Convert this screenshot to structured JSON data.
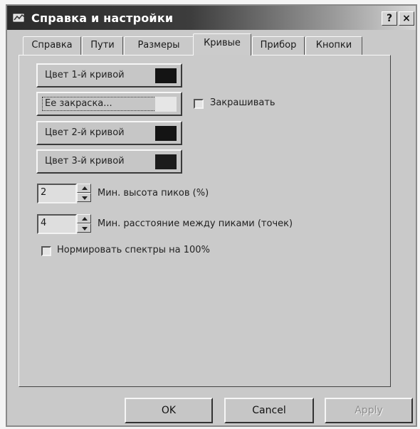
{
  "window": {
    "title": "Справка и настройки",
    "help_label": "?",
    "close_label": "×"
  },
  "tabs": [
    {
      "label": "Справка"
    },
    {
      "label": "Пути"
    },
    {
      "label": "Размеры"
    },
    {
      "label": "Кривые",
      "active": true
    },
    {
      "label": "Прибор"
    },
    {
      "label": "Кнопки"
    }
  ],
  "curves": {
    "color1_label": "Цвет 1-й кривой",
    "fill_label": "Ее закраска...",
    "color2_label": "Цвет 2-й кривой",
    "color3_label": "Цвет 3-й кривой",
    "fill_checkbox_label": "Закрашивать",
    "fill_checked": false,
    "min_peak_height_value": "2",
    "min_peak_height_label": "Мин. высота пиков (%)",
    "min_peak_distance_value": "4",
    "min_peak_distance_label": "Мин. расстояние между пиками (точек)",
    "normalize_label": "Нормировать спектры на 100%",
    "normalize_checked": false,
    "swatch_colors": {
      "color1": "#141414",
      "fill": "#e6e6e6",
      "color2": "#141414",
      "color3": "#1c1c1c"
    }
  },
  "buttons": {
    "ok": "OK",
    "cancel": "Cancel",
    "apply": "Apply"
  },
  "colors": {
    "titlebar_dark": "#2b2b2b",
    "dialog_face": "#c9c9c9"
  }
}
